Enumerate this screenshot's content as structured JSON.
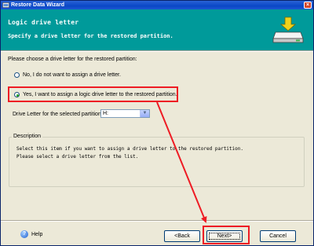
{
  "window": {
    "title": "Restore Data Wizard"
  },
  "banner": {
    "title": "Logic drive letter",
    "subtitle": "Specify a drive letter for the restored partition."
  },
  "main": {
    "prompt": "Please choose a drive letter for the restored partition:",
    "options": [
      {
        "label": "No, I do not want to assign a drive letter.",
        "selected": false
      },
      {
        "label": "Yes, I want to assign a logic drive letter to the restored partition.",
        "selected": true
      }
    ],
    "drive_label": "Drive Letter for the selected partition:",
    "drive_value": "H:"
  },
  "description": {
    "legend": "Description",
    "lines": [
      "Select this item if you want to assign a drive letter to the restored partition.",
      "Please select a drive letter from the list."
    ]
  },
  "footer": {
    "help": "Help",
    "back": "<Back",
    "next": "Next>",
    "cancel": "Cancel"
  },
  "colors": {
    "banner": "#009a9a",
    "highlight": "#ee1c24",
    "titlebar": "#0a47c6"
  },
  "icons": [
    "window-icon",
    "close-icon",
    "drive-icon",
    "help-icon",
    "dropdown-arrow-icon"
  ]
}
